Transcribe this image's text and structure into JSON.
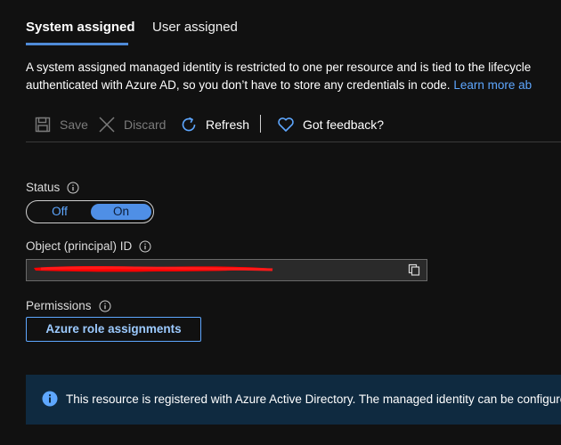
{
  "tabs": [
    {
      "label": "System assigned",
      "active": true
    },
    {
      "label": "User assigned",
      "active": false
    }
  ],
  "description": {
    "line1": "A system assigned managed identity is restricted to one per resource and is tied to the lifecycle",
    "line2": "authenticated with Azure AD, so you don’t have to store any credentials in code.",
    "link_text": "Learn more ab"
  },
  "toolbar": {
    "save_label": "Save",
    "discard_label": "Discard",
    "refresh_label": "Refresh",
    "feedback_label": "Got feedback?"
  },
  "status": {
    "label": "Status",
    "off_label": "Off",
    "on_label": "On",
    "value": "On"
  },
  "object_id": {
    "label": "Object (principal) ID",
    "value": ""
  },
  "permissions": {
    "label": "Permissions",
    "button_label": "Azure role assignments"
  },
  "banner": {
    "text": "This resource is registered with Azure Active Directory. The managed identity can be configured"
  },
  "colors": {
    "background": "#111111",
    "accent": "#4f8fe6",
    "link": "#5ea7ff",
    "banner_bg": "#0f2a40",
    "redaction": "#ff0000"
  }
}
